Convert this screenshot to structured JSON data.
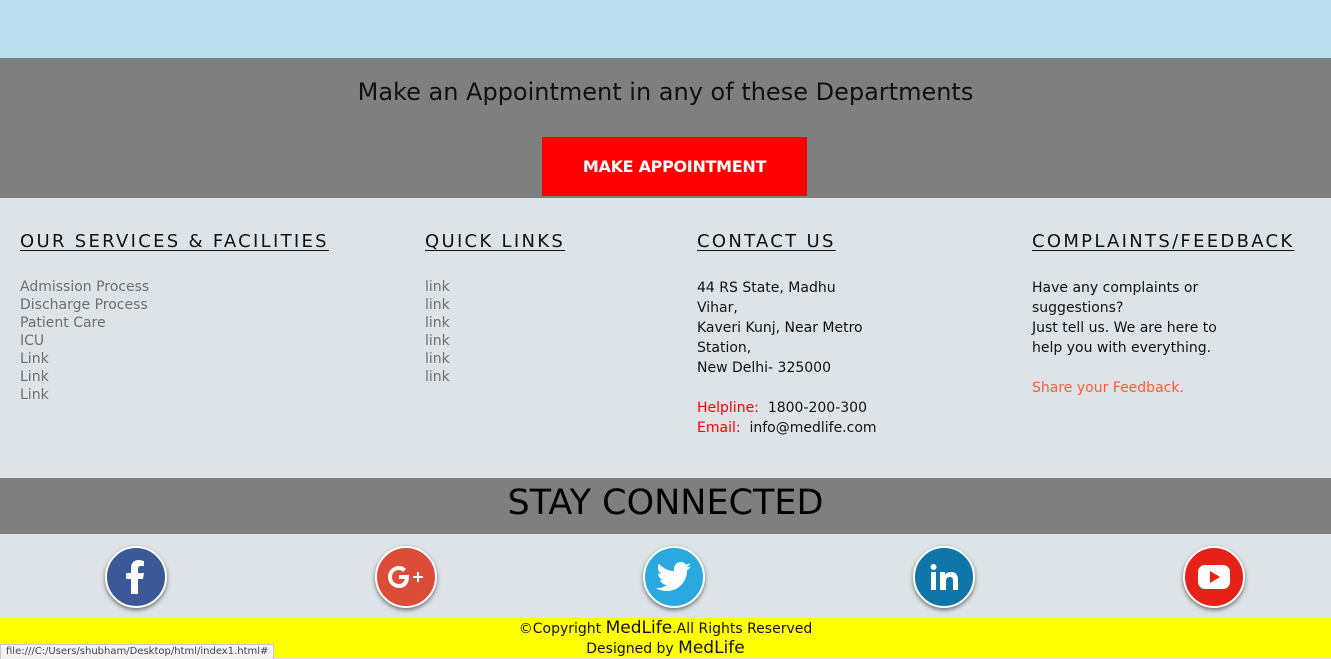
{
  "appointment": {
    "title": "Make an Appointment in any of these Departments",
    "button_label": "MAKE APPOINTMENT"
  },
  "footer": {
    "services": {
      "heading": "OUR SERVICES & FACILITIES",
      "items": [
        "Admission Process",
        "Discharge Process",
        "Patient Care",
        "ICU",
        "Link",
        "Link",
        "Link"
      ]
    },
    "quick_links": {
      "heading": "QUICK LINKS",
      "items": [
        "link",
        "link",
        "link",
        "link",
        "link",
        "link"
      ]
    },
    "contact": {
      "heading": "CONTACT US",
      "address_lines": [
        "44 RS State, Madhu",
        "Vihar,",
        "Kaveri Kunj, Near Metro",
        "Station,",
        "New Delhi- 325000"
      ],
      "helpline_label": "Helpline:",
      "helpline_value": "1800-200-300",
      "email_label": "Email:",
      "email_value": "info@medlife.com"
    },
    "complaints": {
      "heading": "COMPLAINTS/FEEDBACK",
      "text_lines": [
        "Have any complaints or",
        "suggestions?",
        "Just tell us. We are here to",
        "help you with everything."
      ],
      "feedback_link": "Share your Feedback."
    }
  },
  "stay_connected": {
    "title": "STAY CONNECTED",
    "icons": [
      {
        "name": "facebook-icon",
        "color": "#3b5998"
      },
      {
        "name": "google-plus-icon",
        "color": "#dd4b39"
      },
      {
        "name": "twitter-icon",
        "color": "#2aa9e0"
      },
      {
        "name": "linkedin-icon",
        "color": "#0e76a8"
      },
      {
        "name": "youtube-icon",
        "color": "#e62117"
      }
    ]
  },
  "copyright": {
    "prefix": "©Copyright",
    "brand": "MedLife",
    "suffix": ".All Rights Reserved",
    "designed_prefix": "Designed by",
    "designed_brand": "MedLife"
  },
  "status_bar": {
    "url": "file:///C:/Users/shubham/Desktop/html/index1.html#"
  }
}
